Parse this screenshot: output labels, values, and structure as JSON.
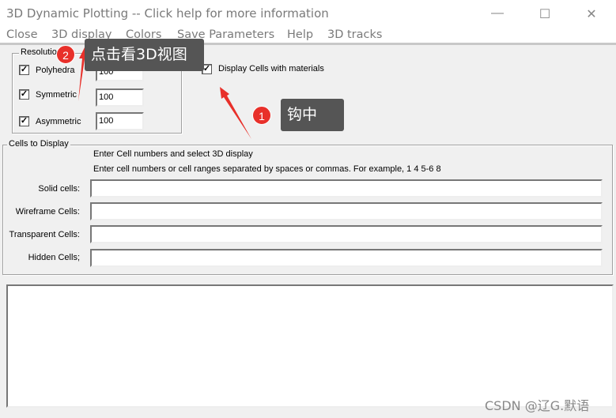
{
  "window": {
    "title": "3D Dynamic Plotting -- Click help for more information",
    "minimize": "—",
    "maximize": "☐",
    "close": "✕"
  },
  "menu": [
    "Close",
    "3D display",
    "Colors",
    "Save Parameters",
    "Help",
    "3D tracks"
  ],
  "resolution": {
    "label": "Resolution",
    "items": [
      {
        "label": "Polyhedra",
        "checked": true,
        "value": "100"
      },
      {
        "label": "Symmetric",
        "checked": true,
        "value": "100"
      },
      {
        "label": "Asymmetric",
        "checked": true,
        "value": "100"
      }
    ]
  },
  "display_materials": {
    "label": "Display Cells with materials",
    "checked": true
  },
  "cells": {
    "label": "Cells to Display",
    "hint1": "Enter Cell numbers and select 3D display",
    "hint2": "Enter cell numbers or cell ranges separated by spaces or commas.  For example, 1 4 5-6 8",
    "fields": [
      {
        "label": "Solid cells:",
        "value": ""
      },
      {
        "label": "Wireframe Cells:",
        "value": ""
      },
      {
        "label": "Transparent Cells:",
        "value": ""
      },
      {
        "label": "Hidden Cells;",
        "value": ""
      }
    ]
  },
  "output": {
    "value": ""
  },
  "annotations": [
    {
      "number": "1",
      "text": "钩中"
    },
    {
      "number": "2",
      "text": "点击看3D视图"
    }
  ],
  "watermark": "CSDN @辽G.默语",
  "colors": {
    "annotation_red": "#e8302a",
    "callout_bg": "#555555"
  }
}
